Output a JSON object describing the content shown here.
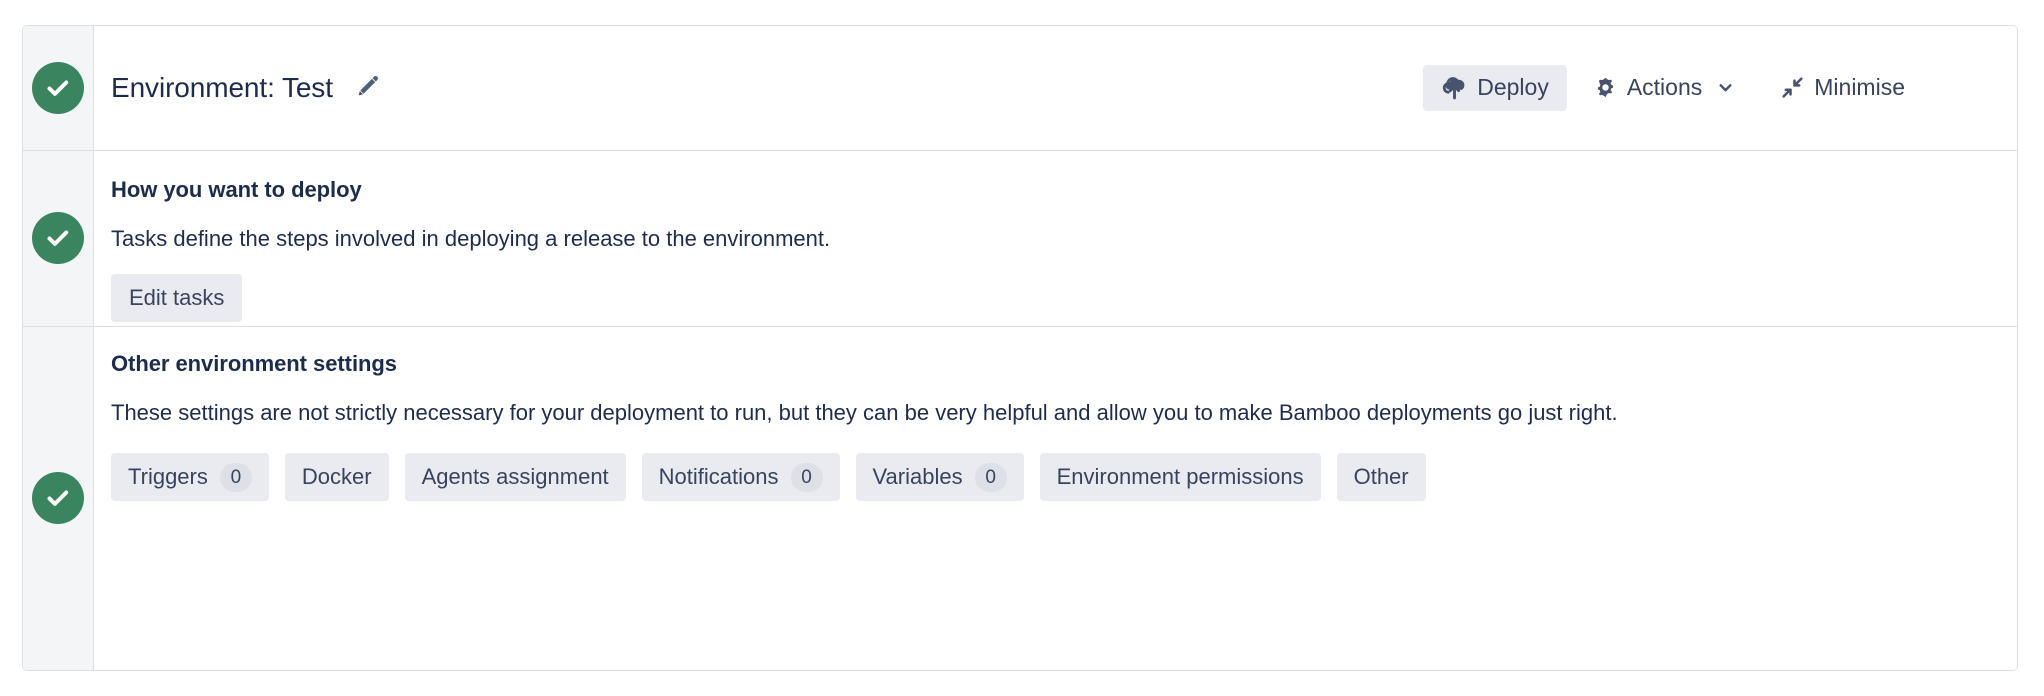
{
  "card": {
    "accent_green": "#3a8560",
    "text_color": "#1d2b4d",
    "chip_background": "#e9ebf0"
  },
  "header": {
    "status": "complete",
    "title": "Environment: Test",
    "edit_icon": "pencil-icon",
    "actions": [
      {
        "label": "Deploy",
        "icon": "cloud-upload-icon",
        "filled": true
      },
      {
        "label": "Actions",
        "icon": "gear-icon",
        "chevron": "chevron-down-icon",
        "filled": false
      },
      {
        "label": "Minimise",
        "icon": "collapse-arrows-icon",
        "filled": false
      }
    ]
  },
  "sections": [
    {
      "status": "complete",
      "title": "How you want to deploy",
      "description": "Tasks define the steps involved in deploying a release to the environment.",
      "button_label": "Edit tasks"
    },
    {
      "status": "complete",
      "title": "Other environment settings",
      "description": "These settings are not strictly necessary for your deployment to run, but they can be very helpful and allow you to make Bamboo deployments go just right.",
      "chips": [
        {
          "label": "Triggers",
          "count": "0"
        },
        {
          "label": "Docker",
          "count": null
        },
        {
          "label": "Agents assignment",
          "count": null
        },
        {
          "label": "Notifications",
          "count": "0"
        },
        {
          "label": "Variables",
          "count": "0"
        },
        {
          "label": "Environment permissions",
          "count": null
        },
        {
          "label": "Other",
          "count": null
        }
      ]
    }
  ]
}
